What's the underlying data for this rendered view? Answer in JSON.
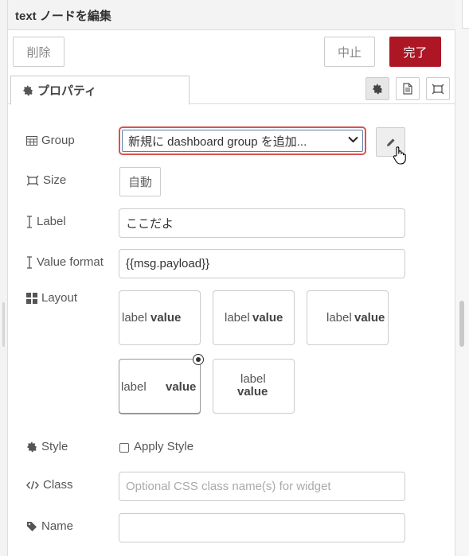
{
  "header": {
    "title": "text ノードを編集"
  },
  "actions": {
    "delete_label": "削除",
    "cancel_label": "中止",
    "done_label": "完了"
  },
  "tabs": {
    "properties_label": "プロパティ"
  },
  "form": {
    "group": {
      "label": "Group",
      "value": "新規に dashboard group を追加..."
    },
    "size": {
      "label": "Size",
      "button_label": "自動"
    },
    "label": {
      "label": "Label",
      "value": "ここだよ"
    },
    "value_format": {
      "label": "Value format",
      "value": "{{msg.payload}}"
    },
    "layout": {
      "label": "Layout",
      "options": [
        {
          "label": "label",
          "value": "value",
          "selected": false
        },
        {
          "label": "label",
          "value": "value",
          "selected": false
        },
        {
          "label": "label",
          "value": "value",
          "selected": false
        },
        {
          "label": "label",
          "value": "value",
          "selected": true
        },
        {
          "label": "label",
          "value": "value",
          "selected": false
        }
      ]
    },
    "style": {
      "label": "Style",
      "checkbox_label": "Apply Style",
      "checked": false
    },
    "class": {
      "label": "Class",
      "placeholder": "Optional CSS class name(s) for widget",
      "value": ""
    },
    "name": {
      "label": "Name",
      "value": ""
    }
  },
  "colors": {
    "done_button": "#ad1625",
    "error_border": "#d9534f",
    "header_bg": "#f3f3f3"
  }
}
